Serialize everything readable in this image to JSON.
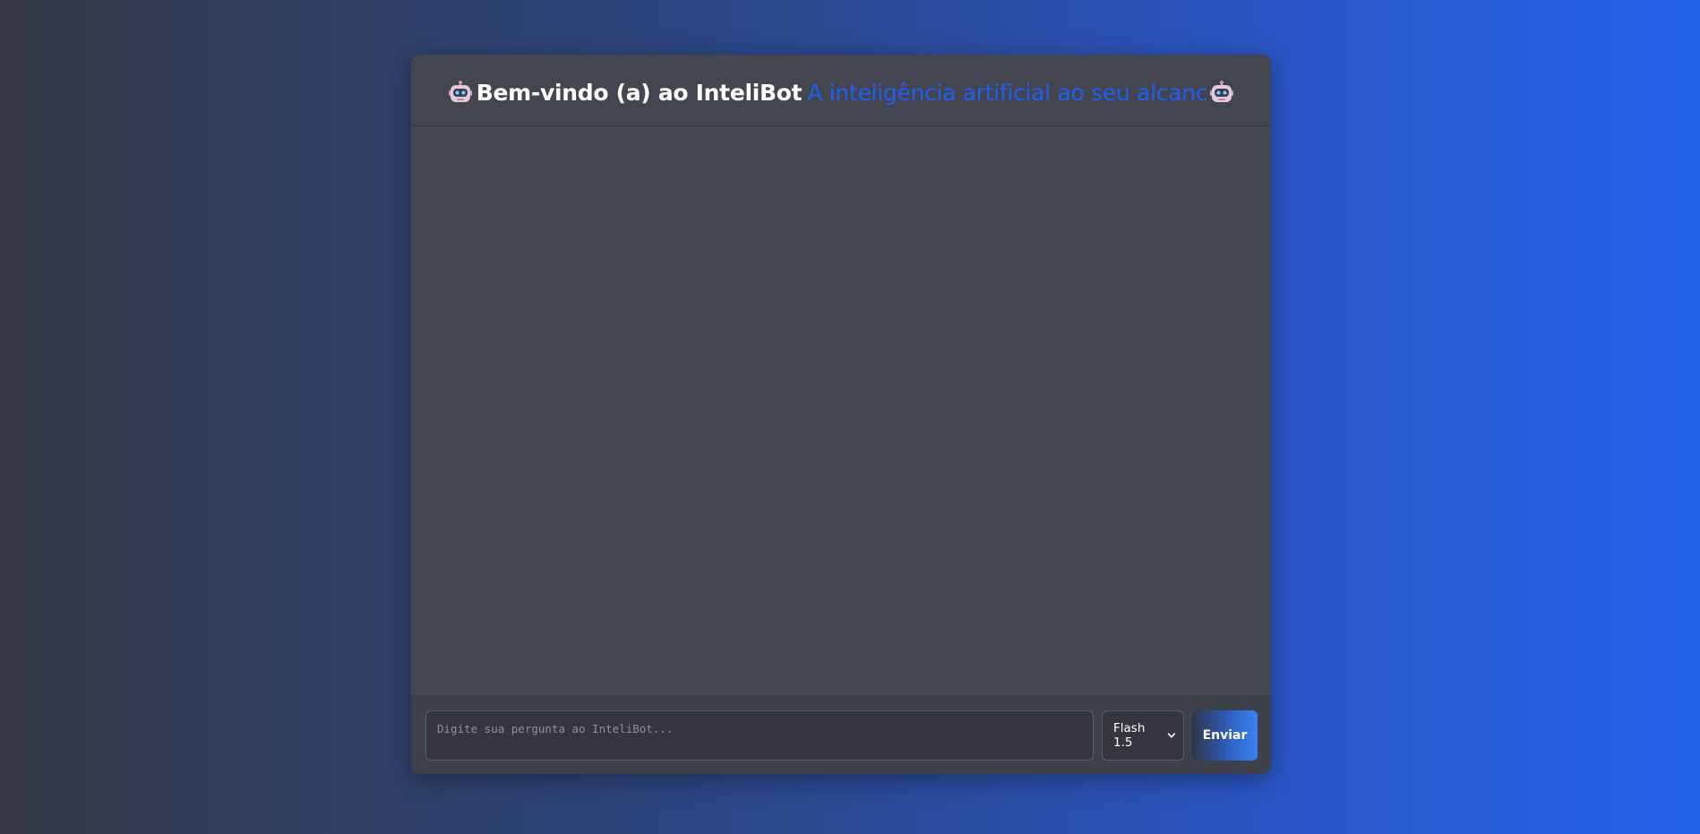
{
  "header": {
    "title_main": "Bem-vindo (a) ao InteliBot",
    "title_accent": "A inteligência artificial ao seu alcanc",
    "left_icon": "robot-icon",
    "right_icon": "robot-icon"
  },
  "input": {
    "placeholder": "Digite sua pergunta ao InteliBot...",
    "value": ""
  },
  "model_select": {
    "selected": "Flash 1.5"
  },
  "send_button": {
    "label": "Enviar"
  },
  "colors": {
    "accent": "#1f5ff0",
    "card": "#434551",
    "input_bg": "#343541"
  }
}
